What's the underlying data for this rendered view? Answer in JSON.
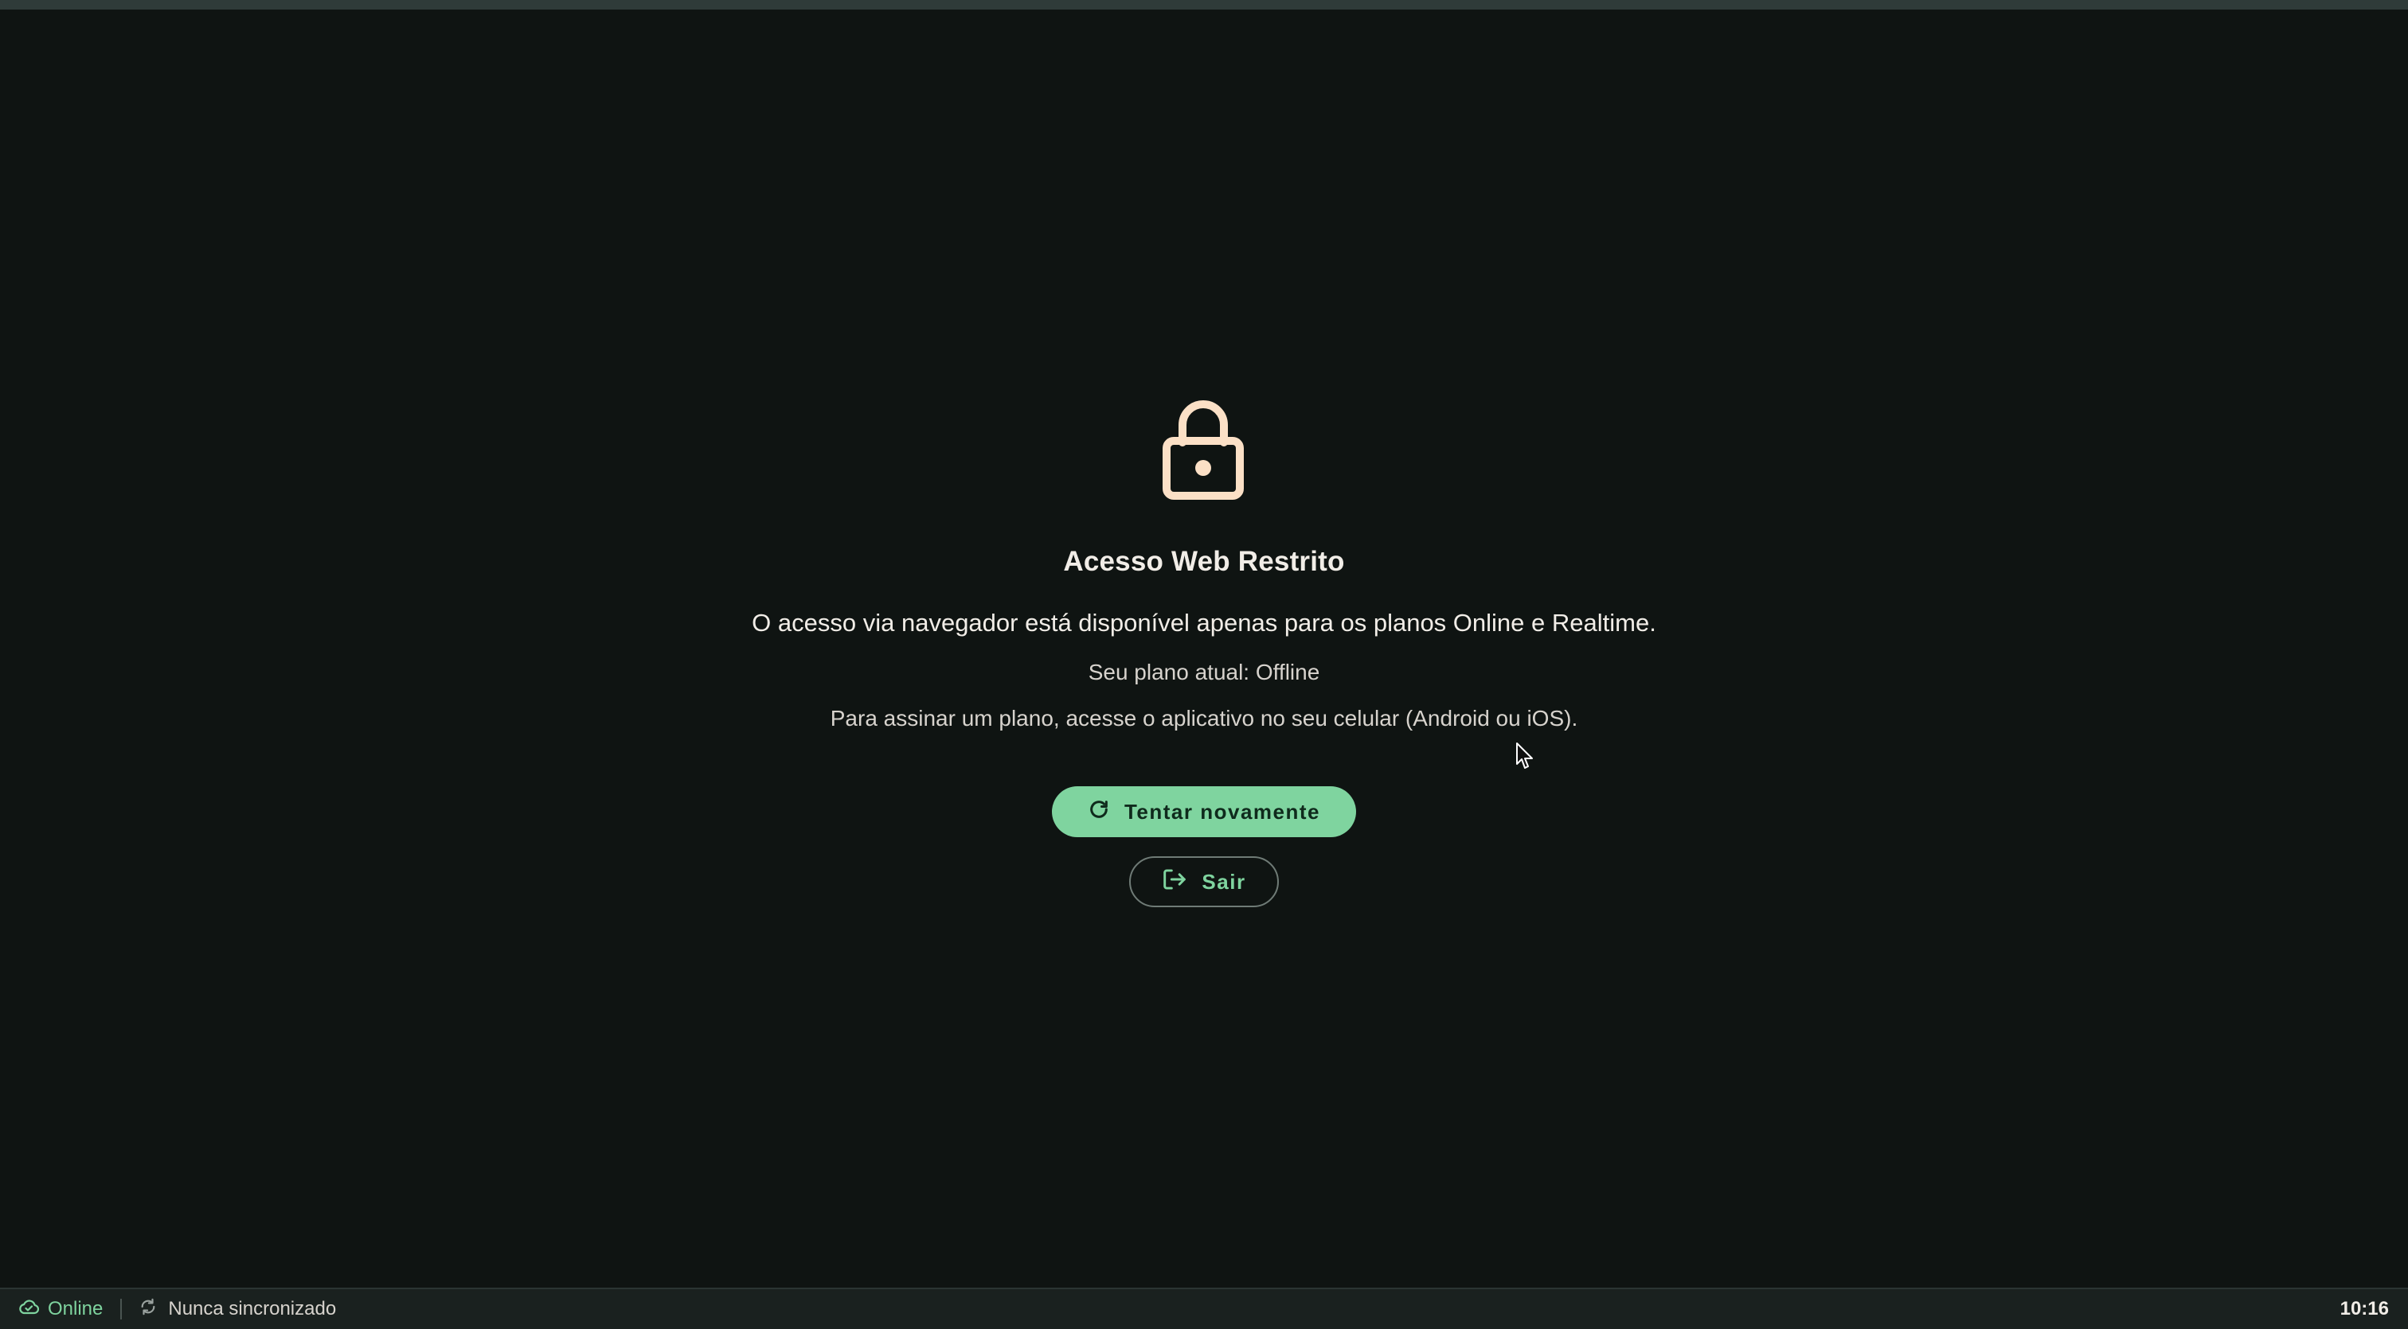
{
  "lock": {
    "icon": "lock-icon",
    "color": "#fbe0c6"
  },
  "title": "Acesso Web Restrito",
  "description": "O acesso via navegador está disponível apenas para os planos Online e Realtime.",
  "current_plan": "Seu plano atual: Offline",
  "hint": "Para assinar um plano, acesse o aplicativo no seu celular (Android ou iOS).",
  "buttons": {
    "retry": {
      "label": "Tentar novamente",
      "icon": "refresh-icon"
    },
    "exit": {
      "label": "Sair",
      "icon": "logout-icon"
    }
  },
  "statusbar": {
    "connection": {
      "label": "Online",
      "icon": "cloud-check-icon"
    },
    "sync": {
      "label": "Nunca sincronizado",
      "icon": "sync-icon"
    },
    "time": "10:16"
  },
  "colors": {
    "background": "#0f1412",
    "accent": "#7fd49f",
    "lock": "#fbe0c6"
  }
}
